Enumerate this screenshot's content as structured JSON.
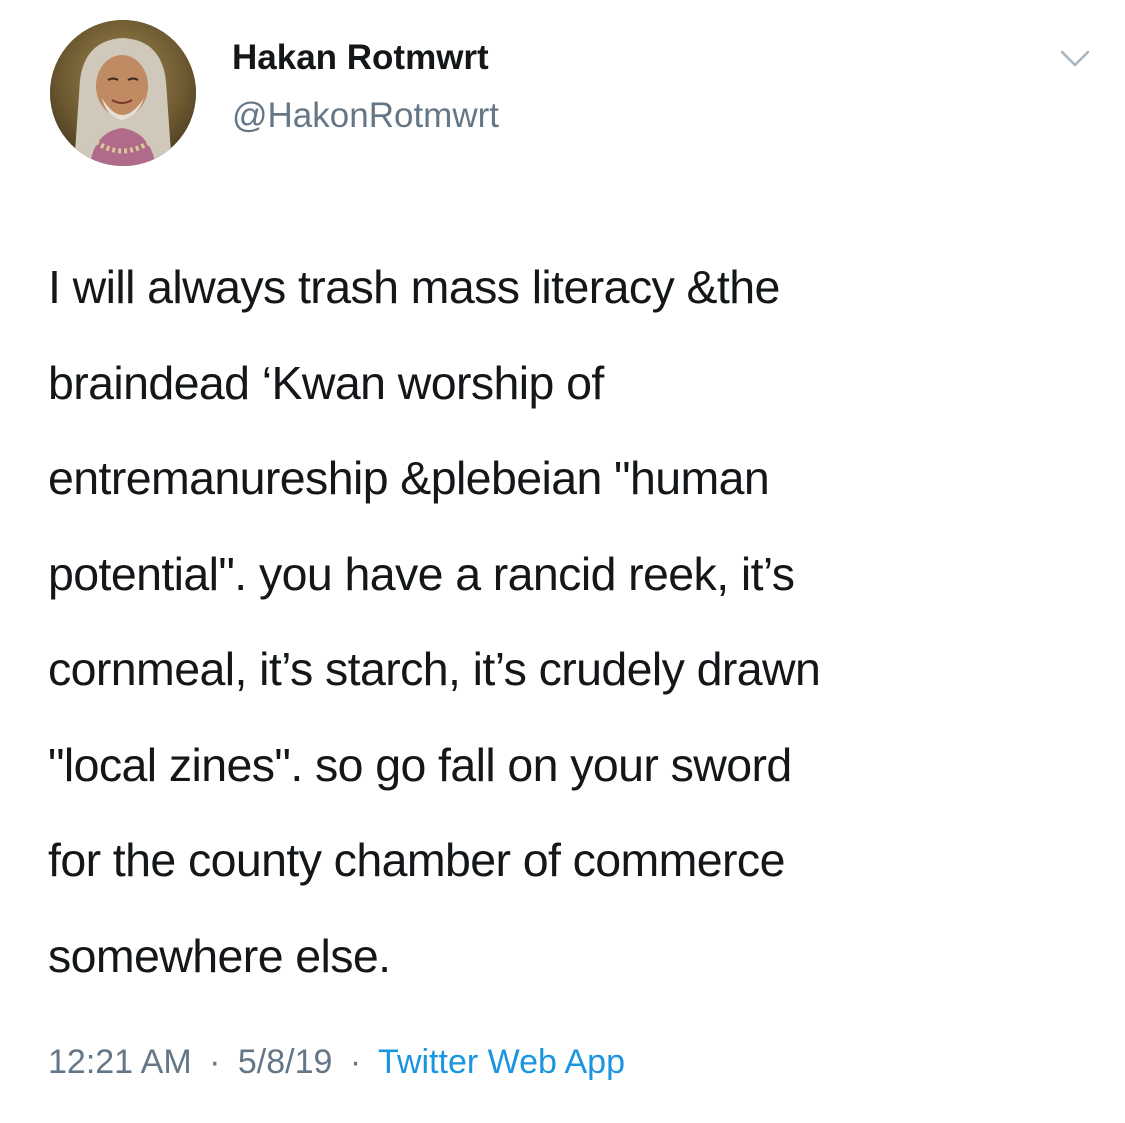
{
  "author": {
    "display_name": "Hakan Rotmwrt",
    "handle": "@HakonRotmwrt",
    "avatar_icon": "profile-photo"
  },
  "menu": {
    "icon": "chevron-down-icon"
  },
  "tweet": {
    "lines": [
      "I will always trash mass literacy &the",
      "braindead ‘Kwan worship of",
      "entremanureship &plebeian \"human",
      "potential\". you have a rancid reek, it’s",
      "cornmeal, it’s starch, it’s crudely drawn",
      "\"local zines\". so go fall on your sword",
      "for the county chamber of commerce",
      "somewhere else."
    ]
  },
  "meta": {
    "time": "12:21 AM",
    "date": "5/8/19",
    "separator": "·",
    "source": "Twitter Web App"
  },
  "colors": {
    "text": "#14171a",
    "secondary": "#657786",
    "link": "#1b95e0",
    "background": "#ffffff"
  }
}
